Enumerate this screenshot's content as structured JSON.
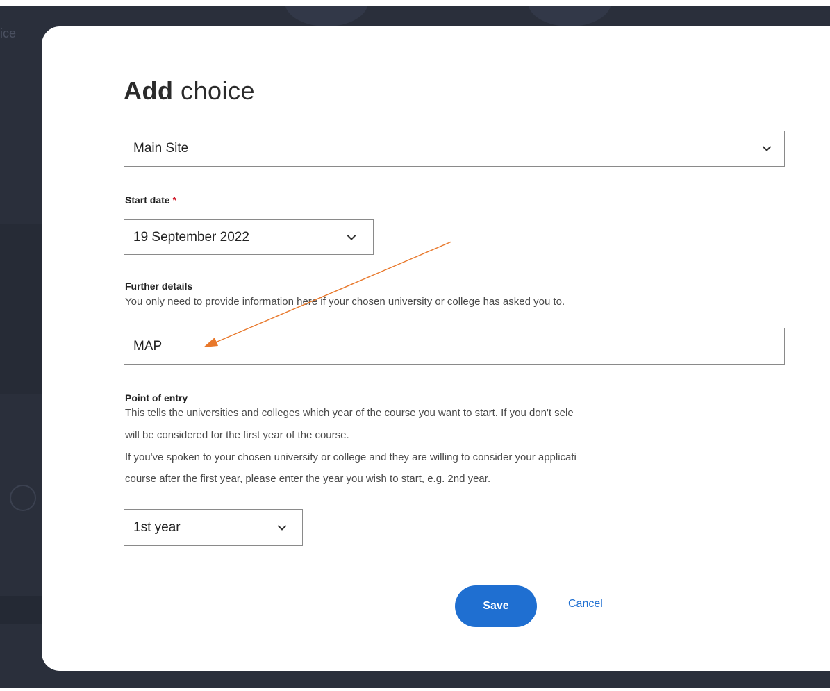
{
  "background": {
    "partial_text": "ice"
  },
  "modal": {
    "title_bold": "Add",
    "title_rest": " choice",
    "site_select": {
      "value": "Main Site"
    },
    "start_date": {
      "label": "Start date",
      "required_mark": "*",
      "value": "19 September 2022"
    },
    "further_details": {
      "label": "Further details",
      "hint": "You only need to provide information here if your chosen university or college has asked you to.",
      "value": "MAP"
    },
    "point_of_entry": {
      "label": "Point of entry",
      "hint_line1": "This tells the universities and colleges which year of the course you want to start. If you don't sele",
      "hint_line2": "will be considered for the first year of the course.",
      "hint_line3": "If you've spoken to your chosen university or college and they are willing to consider your applicati",
      "hint_line4": "course after the first year, please enter the year you wish to start, e.g. 2nd year.",
      "value": "1st year"
    },
    "save_label": "Save",
    "cancel_label": "Cancel"
  },
  "icons": {
    "select_chevron": "chevron-down-icon",
    "annotation": "arrow-icon"
  },
  "colors": {
    "backdrop": "#2a2f3b",
    "primary": "#1f6fd1",
    "required": "#d21f2e",
    "annotation_arrow": "#e8782b"
  }
}
